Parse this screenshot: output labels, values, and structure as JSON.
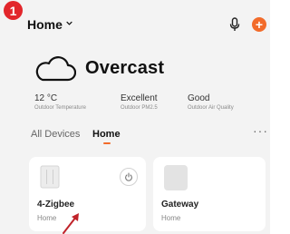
{
  "annotation": {
    "step_number": "1",
    "color": "#e2262b"
  },
  "header": {
    "home_label": "Home",
    "icons": [
      "chevron-down-icon",
      "microphone-icon",
      "add-icon"
    ],
    "add_button_color": "#f26b2a",
    "add_label": "+"
  },
  "weather": {
    "icon": "cloud-icon",
    "condition": "Overcast",
    "stats": [
      {
        "value": "12 °C",
        "label": "Outdoor Temperature"
      },
      {
        "value": "Excellent",
        "label": "Outdoor PM2.5"
      },
      {
        "value": "Good",
        "label": "Outdoor Air Quality"
      }
    ]
  },
  "tabs": {
    "items": [
      "All Devices",
      "Home"
    ],
    "active": "Home",
    "more_label": "···",
    "accent_color": "#f26b2a"
  },
  "devices": [
    {
      "name": "4-Zigbee",
      "room": "Home",
      "icon": "zigbee-device-icon",
      "has_power_button": true
    },
    {
      "name": "Gateway",
      "room": "Home",
      "icon": "gateway-icon",
      "has_power_button": false
    }
  ]
}
